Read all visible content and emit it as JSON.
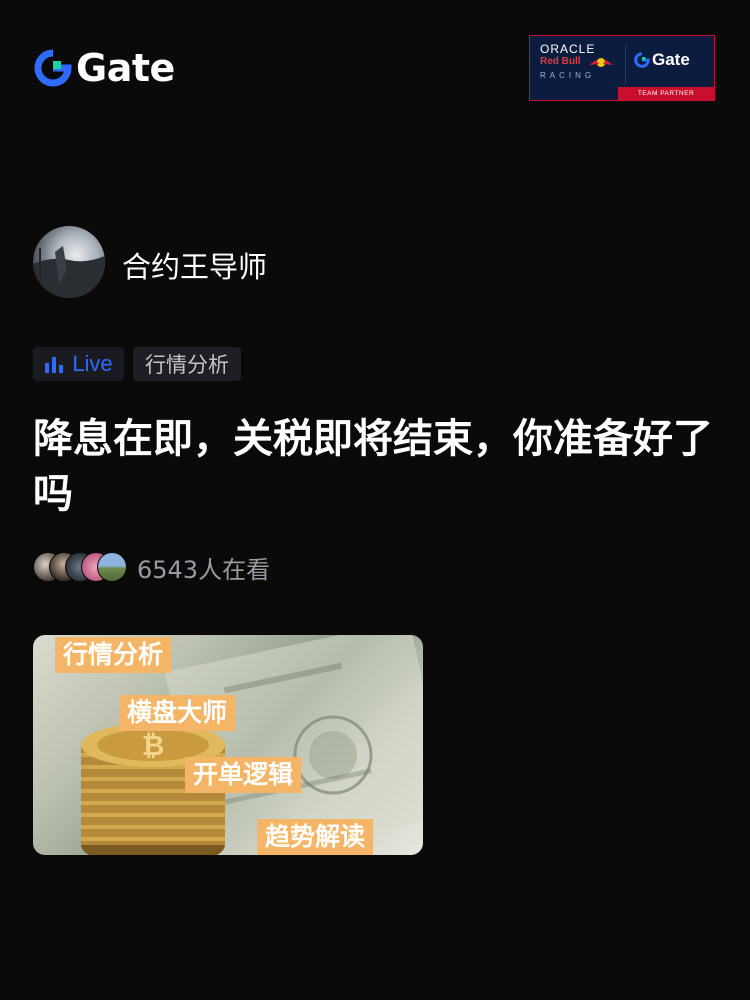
{
  "header": {
    "logo_text": "Gate",
    "partner": {
      "line1": "ORACLE",
      "line2": "Red Bull",
      "line3": "RACING",
      "logo_text": "Gate",
      "footer": "TEAM PARTNER"
    }
  },
  "host": {
    "name": "合约王导师"
  },
  "tags": {
    "live": "Live",
    "category": "行情分析"
  },
  "title": "降息在即，关税即将结束，你准备好了吗",
  "viewers": {
    "count_text": "6543人在看"
  },
  "thumbnail": {
    "labels": [
      "行情分析",
      "横盘大师",
      "开单逻辑",
      "趋势解读"
    ]
  },
  "colors": {
    "background": "#0a0a0b",
    "accent_blue": "#2f6bff",
    "logo_green": "#17d4a0",
    "badge_orange": "#f4b566"
  },
  "icons": [
    "gate-logo-icon",
    "live-bars-icon",
    "red-bull-icon"
  ]
}
